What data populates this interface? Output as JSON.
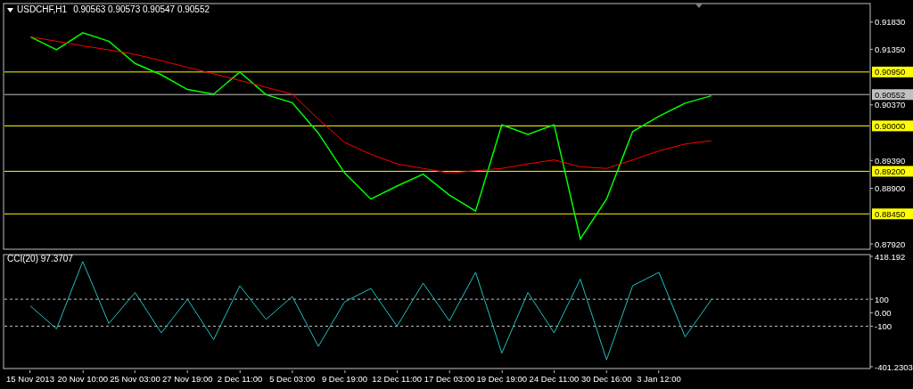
{
  "header": {
    "symbol": "USDCHF,H1",
    "prices": "0.90563 0.90573 0.90547 0.90552"
  },
  "price_chart": {
    "chart_data": {
      "type": "line",
      "categories": [
        null,
        null,
        null,
        null,
        null,
        null,
        null,
        null,
        null,
        null,
        null,
        null,
        null,
        null,
        null,
        null,
        null,
        null,
        null,
        null,
        null,
        null,
        null,
        null,
        null,
        null,
        null,
        null,
        null,
        null,
        null,
        null
      ],
      "series": [
        {
          "color": "#00ff00",
          "values": [
            0.9157,
            0.9134,
            0.9164,
            0.9149,
            0.911,
            0.909,
            0.9064,
            0.9056,
            0.9095,
            0.9055,
            0.9041,
            0.8987,
            0.8917,
            0.8871,
            0.8894,
            0.8915,
            0.8878,
            0.885,
            0.9002,
            0.8985,
            0.9002,
            0.8801,
            0.8871,
            0.899,
            0.9017,
            0.904,
            0.9053,
            null,
            null,
            null,
            null,
            null
          ]
        },
        {
          "color": "#ff0000",
          "values": [
            0.9157,
            0.9149,
            0.9141,
            0.9134,
            0.9126,
            0.9115,
            0.9103,
            0.9092,
            0.908,
            0.9068,
            0.9056,
            0.9012,
            0.8971,
            0.895,
            0.8933,
            0.8925,
            0.8917,
            0.8921,
            0.8925,
            0.8933,
            0.894,
            0.8928,
            0.8925,
            0.894,
            0.8956,
            0.8968,
            0.8974,
            null,
            null,
            null,
            null,
            null
          ]
        }
      ],
      "ylim": [
        0.87858,
        0.92124
      ],
      "yticks": [
        {
          "value": 0.9183,
          "label": "0.91830"
        },
        {
          "value": 0.9135,
          "label": "0.91350"
        },
        {
          "value": 0.9037,
          "label": "0.90370"
        },
        {
          "value": 0.8939,
          "label": "0.89390"
        },
        {
          "value": 0.889,
          "label": "0.88900"
        },
        {
          "value": 0.8792,
          "label": "0.87920"
        }
      ],
      "ref_lines": [
        {
          "axis": "y",
          "value": 0.9095,
          "label": "0.90950",
          "color": "#ffff00"
        },
        {
          "axis": "y",
          "value": 0.90552,
          "label": "0.90552",
          "color": "#c0c0c0"
        },
        {
          "axis": "y",
          "value": 0.9,
          "label": "0.90000",
          "color": "#ffff00"
        },
        {
          "axis": "y",
          "value": 0.892,
          "label": "0.89200",
          "color": "#ffff00"
        },
        {
          "axis": "y",
          "value": 0.8845,
          "label": "0.88450",
          "color": "#ffff00"
        }
      ]
    }
  },
  "indicator": {
    "title": "CCI(20) 97.3707",
    "chart_data": {
      "type": "line",
      "categories": [
        "15 Nov 2013",
        null,
        "20 Nov 10:00",
        null,
        "25 Nov 03:00",
        null,
        "27 Nov 19:00",
        null,
        "2 Dec 11:00",
        null,
        "5 Dec 03:00",
        null,
        "9 Dec 19:00",
        null,
        "12 Dec 11:00",
        null,
        "17 Dec 03:00",
        null,
        "19 Dec 19:00",
        null,
        "24 Dec 11:00",
        null,
        "30 Dec 16:00",
        null,
        "3 Jan 12:00",
        null,
        null,
        null,
        null,
        null,
        null,
        null
      ],
      "series": [
        {
          "color": "#20c0c0",
          "values": [
            50,
            -120,
            380,
            -80,
            150,
            -150,
            100,
            -200,
            200,
            -50,
            120,
            -250,
            80,
            180,
            -100,
            220,
            -60,
            300,
            -300,
            150,
            -150,
            250,
            -350,
            200,
            300,
            -180,
            97,
            null,
            null,
            null,
            null,
            null
          ]
        }
      ],
      "ylim": [
        -401.2303,
        418.192
      ],
      "yticks": [
        {
          "value": 418.192,
          "label": "418.192"
        },
        {
          "value": 100,
          "label": "100"
        },
        {
          "value": 0,
          "label": "0.00"
        },
        {
          "value": -100,
          "label": "-100"
        },
        {
          "value": -401.2303,
          "label": "-401.2303"
        }
      ],
      "ref_lines": [
        {
          "axis": "y",
          "value": 100
        },
        {
          "axis": "y",
          "value": -100
        }
      ]
    }
  }
}
